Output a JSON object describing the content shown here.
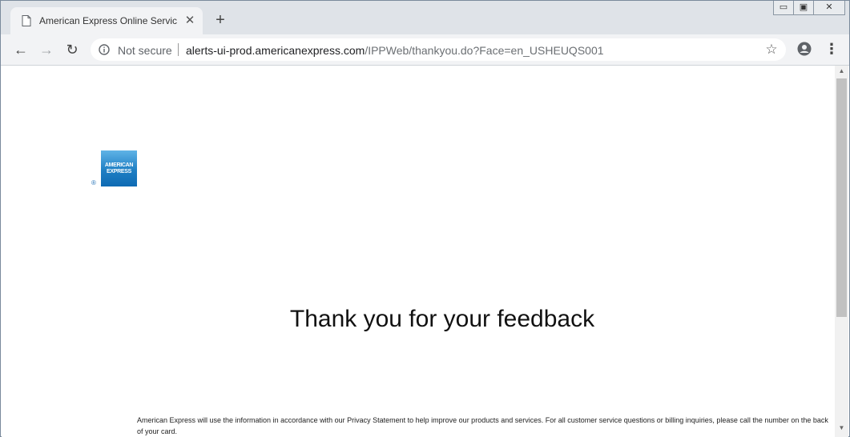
{
  "browser": {
    "tab_title": "American Express Online Services",
    "tab_close_glyph": "✕",
    "new_tab_glyph": "+",
    "window_controls": {
      "minimize": "▭",
      "maximize": "▣",
      "close": "✕"
    },
    "nav": {
      "back": "←",
      "forward": "→",
      "reload": "↻"
    },
    "security_label": "Not secure",
    "url_host": "alerts-ui-prod.americanexpress.com",
    "url_path": "/IPPWeb/thankyou.do?Face=en_USHEUQS001",
    "star_glyph": "☆",
    "menu_glyph": "⋮"
  },
  "page": {
    "logo": {
      "line1": "AMERICAN",
      "line2": "EXPRESS",
      "registered": "®"
    },
    "heading": "Thank you for your feedback",
    "footer": "American Express will use the information in accordance with our Privacy Statement to help improve our products and services. For all customer service questions or billing inquiries, please call the number on the back of your card."
  },
  "scrollbar": {
    "up": "▲",
    "down": "▼"
  },
  "colors": {
    "amex_blue": "#1f7fc4",
    "tabstrip_bg": "#dfe3e8",
    "toolbar_bg": "#f2f3f5"
  },
  "icons": [
    "page-icon",
    "info-icon",
    "star-icon",
    "profile-icon",
    "menu-icon",
    "back-arrow-icon",
    "forward-arrow-icon",
    "reload-icon"
  ]
}
